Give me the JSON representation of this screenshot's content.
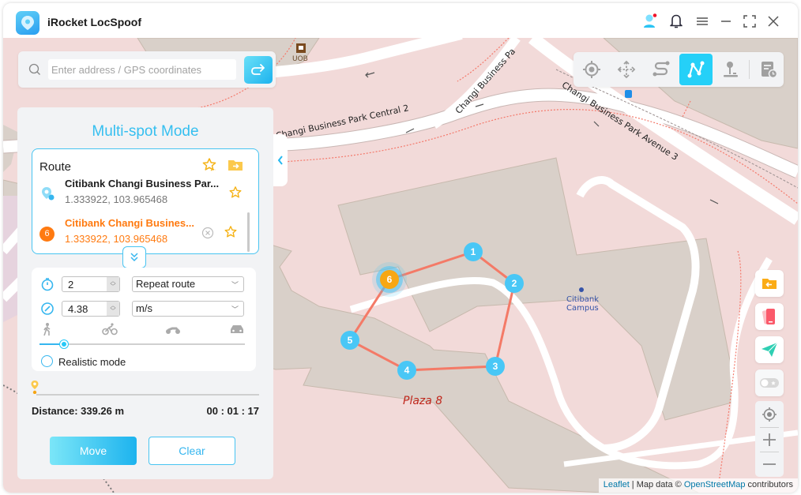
{
  "app": {
    "title": "iRocket LocSpoof",
    "titlebar_icons": [
      "user-avatar-icon",
      "bell-icon",
      "menu-icon",
      "minimize-icon",
      "maximize-icon",
      "close-icon"
    ]
  },
  "search": {
    "placeholder": "Enter address / GPS coordinates",
    "value": ""
  },
  "mode_toolbar": {
    "buttons": [
      {
        "name": "teleport-mode",
        "icon": "crosshair-icon",
        "active": false
      },
      {
        "name": "joystick-move-mode",
        "icon": "move-arrows-icon",
        "active": false
      },
      {
        "name": "two-spot-mode",
        "icon": "route-s-icon",
        "active": false
      },
      {
        "name": "multi-spot-mode",
        "icon": "multi-spot-icon",
        "active": true
      },
      {
        "name": "joystick-mode",
        "icon": "joystick-icon",
        "active": false
      },
      {
        "name": "history",
        "icon": "history-icon",
        "active": false
      }
    ],
    "accent": "#25d0f8"
  },
  "panel": {
    "title": "Multi-spot Mode",
    "route": {
      "label": "Route",
      "items": [
        {
          "name": "Citibank Changi Business Par...",
          "coords": "1.333922, 103.965468",
          "type": "start"
        },
        {
          "name": "Citibank Changi Busines...",
          "coords": "1.333922, 103.965468",
          "type": "current",
          "index": "6"
        }
      ]
    },
    "settings": {
      "repeat_count": "2",
      "repeat_mode": "Repeat route",
      "speed": "4.38",
      "speed_unit": "m/s",
      "speed_presets": [
        "walk-icon",
        "bike-icon",
        "motorbike-icon",
        "car-icon"
      ],
      "speed_slider_fraction": 0.12,
      "realistic_mode_label": "Realistic mode",
      "realistic_mode_checked": false
    },
    "progress_fraction": 0.0,
    "distance": "Distance: 339.26 m",
    "duration": "00 : 01 : 17",
    "move_label": "Move",
    "clear_label": "Clear"
  },
  "map": {
    "labels": {
      "uob": "UOB",
      "road_central2": "Changi Business Park Central 2",
      "road_cbp": "Changi Business Pa",
      "road_avenue3": "Changi Business Park Avenue 3",
      "citibank": "Citibank",
      "campus": "Campus",
      "plaza": "Plaza 8"
    },
    "waypoints": [
      "1",
      "2",
      "3",
      "4",
      "5",
      "6"
    ],
    "route_color": "#f47a67",
    "waypoint_color": "#49c7f6",
    "current_color": "#f7a713"
  },
  "attribution": {
    "leaflet": "Leaflet",
    "mid": " | Map data © ",
    "osm": "OpenStreetMap",
    "tail": " contributors"
  },
  "side_tools": [
    "import-folder-icon",
    "device-icon",
    "send-icon",
    "toggle-icon"
  ],
  "zoom_controls": [
    "locate-icon",
    "zoom-in-icon",
    "zoom-out-icon"
  ]
}
